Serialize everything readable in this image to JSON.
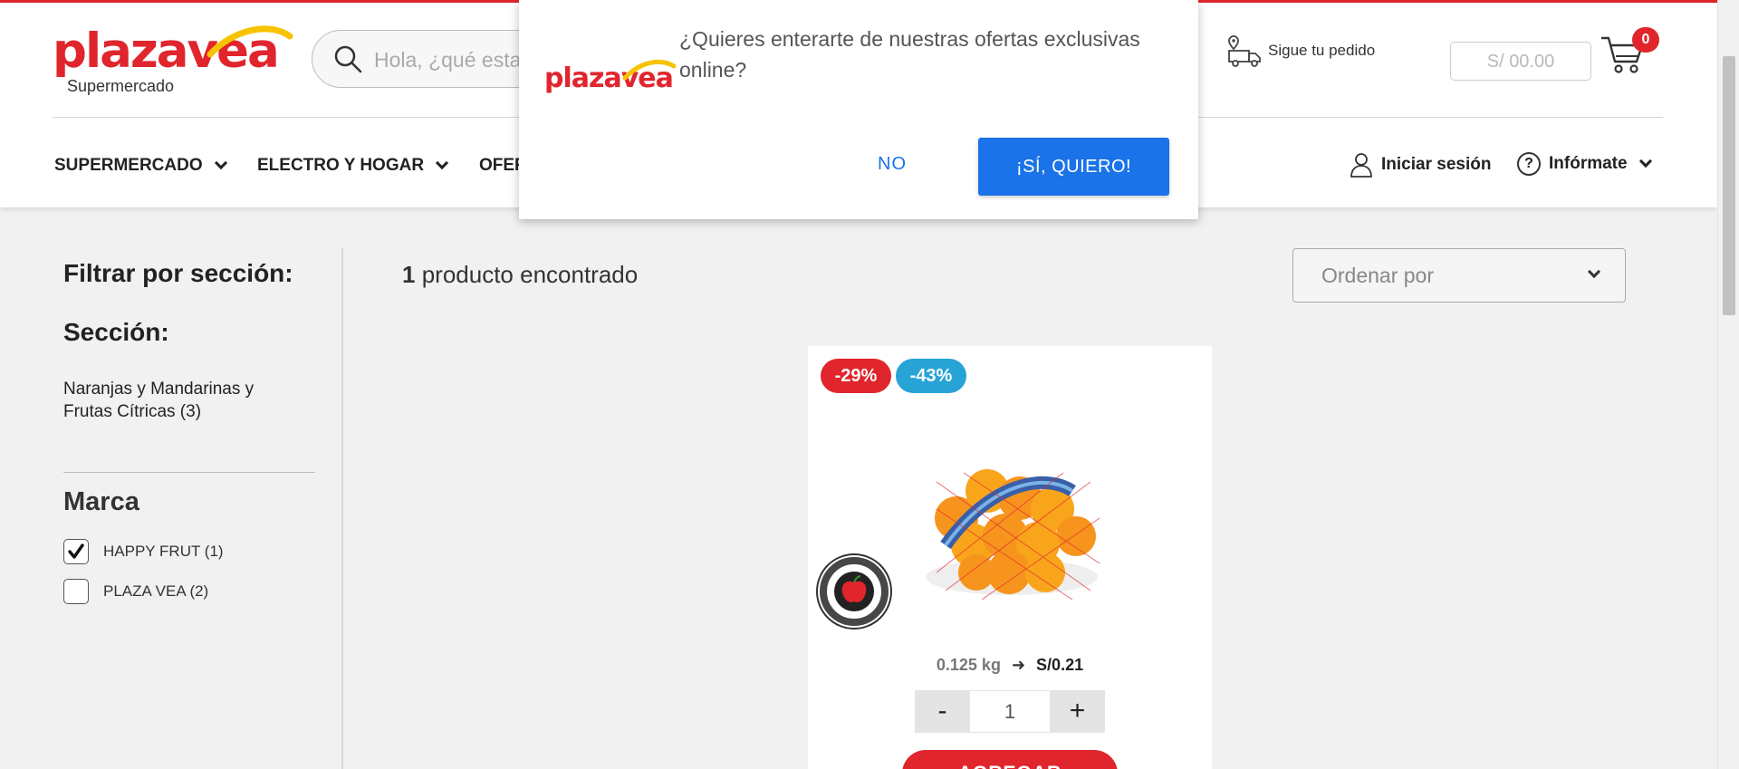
{
  "header": {
    "logo_text": "plazavea",
    "logo_sub": "Supermercado",
    "search_placeholder": "Hola, ¿qué esta",
    "track_order": "Sigue tu pedido",
    "cart_total": "S/ 00.00",
    "cart_count": "0",
    "nav": [
      {
        "label": "SUPERMERCADO"
      },
      {
        "label": "ELECTRO Y HOGAR"
      },
      {
        "label": "OFER"
      }
    ],
    "login": "Iniciar sesión",
    "inform": "Infórmate"
  },
  "modal": {
    "logo_text": "plazavea",
    "message": "¿Quieres enterarte de nuestras ofertas exclusivas online?",
    "no_label": "NO",
    "yes_label": "¡SÍ, QUIERO!"
  },
  "sidebar": {
    "filter_title": "Filtrar por sección:",
    "section_title": "Sección:",
    "section_link": "Naranjas y Mandarinas y Frutas Cítricas (3)",
    "brand_title": "Marca",
    "brands": [
      {
        "label": "HAPPY FRUT (1)",
        "checked": true
      },
      {
        "label": "PLAZA VEA (2)",
        "checked": false
      }
    ]
  },
  "results": {
    "count_number": "1",
    "count_text": "producto encontrado",
    "sort_label": "Ordenar por"
  },
  "product": {
    "badge_red": "-29%",
    "badge_blue": "-43%",
    "weight": "0.125 kg",
    "arrow": "➜",
    "unit_price": "S/0.21",
    "minus": "-",
    "quantity": "1",
    "plus": "+",
    "add_label": "AGREGAR",
    "seal_text": "LAS EXPERTAS ESCOGEN POR TI · COMO LO HACES TÚ"
  },
  "colors": {
    "brand_red": "#e0252d",
    "brand_yellow": "#f7c300",
    "modal_blue": "#1a73e8",
    "badge_blue": "#27a3d6"
  },
  "icons": [
    "search-icon",
    "truck-location-icon",
    "cart-icon",
    "user-icon",
    "question-icon",
    "chevron-down-icon",
    "checkmark-icon"
  ]
}
